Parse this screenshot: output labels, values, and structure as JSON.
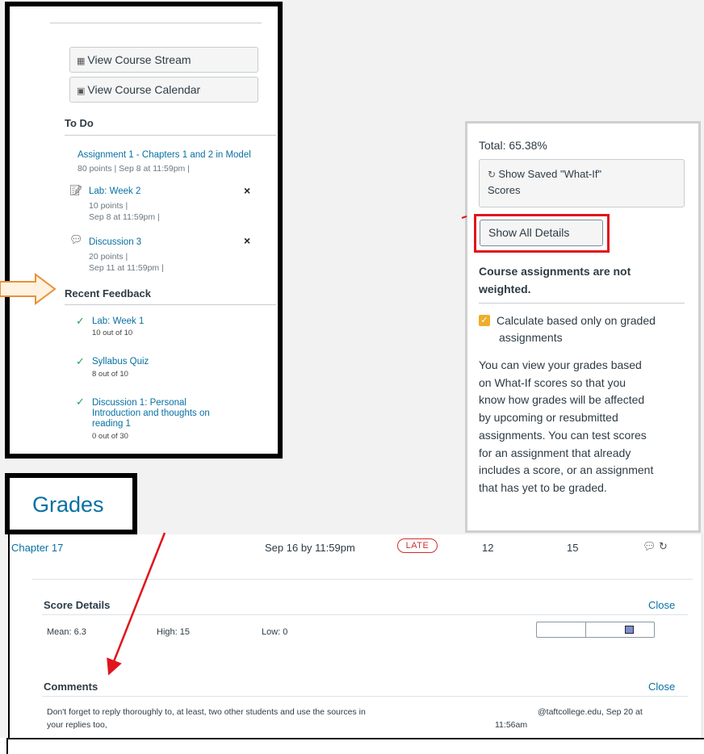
{
  "left_panel": {
    "buttons": {
      "stream": {
        "icon": "chart-icon",
        "label": "View Course Stream"
      },
      "calendar": {
        "icon": "calendar-icon",
        "label": "View Course Calendar"
      }
    },
    "todo": {
      "heading": "To Do",
      "items": [
        {
          "title": "Assignment 1 - Chapters 1 and 2 in Model",
          "meta1": "80 points  |  Sep 8 at 11:59pm  |"
        },
        {
          "title": "Lab: Week 2",
          "meta1": "10 points  |",
          "meta2": "Sep 8 at 11:59pm  |",
          "dismiss": "×"
        },
        {
          "title": "Discussion 3",
          "meta1": "20 points  |",
          "meta2": "Sep 11 at 11:59pm  |",
          "dismiss": "×"
        }
      ]
    },
    "feedback": {
      "heading": "Recent Feedback",
      "items": [
        {
          "line1": "Lab: Week 1",
          "score": "10 out of 10"
        },
        {
          "line1": "Syllabus Quiz",
          "score": "8 out of 10"
        },
        {
          "line1": "Discussion 1: Personal",
          "line2": "Introduction and thoughts on",
          "line3": "reading 1",
          "score": "0 out of 30"
        }
      ]
    }
  },
  "right_panel": {
    "total": "Total: 65.38%",
    "whatif_line1": "Show Saved \"What-If\"",
    "whatif_line2": "Scores",
    "show_all": "Show All Details",
    "weighted_line1": "Course assignments are not",
    "weighted_line2": "weighted.",
    "checkbox_line1": "Calculate based only on graded",
    "checkbox_line2": "assignments",
    "help": [
      "You can view your grades based",
      "on What-If scores so that you",
      "know how grades will be affected",
      "by upcoming or resubmitted",
      "assignments. You can test scores",
      "for an assignment that already",
      "includes a score, or an assignment",
      "that has yet to be graded."
    ]
  },
  "grades_tab": {
    "label": "Grades"
  },
  "assignment_row": {
    "name": "Chapter 17",
    "due": "Sep 16 by 11:59pm",
    "badge": "LATE",
    "score": "12",
    "out_of": "15"
  },
  "score_details": {
    "heading": "Score Details",
    "close": "Close",
    "mean": "Mean: 6.3",
    "high": "High: 15",
    "low": "Low: 0"
  },
  "comments": {
    "heading": "Comments",
    "close": "Close",
    "text_line1": "Don't forget to reply thoroughly to, at least, two other students and use the sources in",
    "text_line2": "your replies too,",
    "author_line1": "@taftcollege.edu, Sep 20 at",
    "author_line2": "11:56am"
  },
  "colors": {
    "link": "#0770a3",
    "late": "#d12e2e",
    "highlight": "#e0141c",
    "check": "#22a05a",
    "checkbox": "#f0ad2b"
  }
}
